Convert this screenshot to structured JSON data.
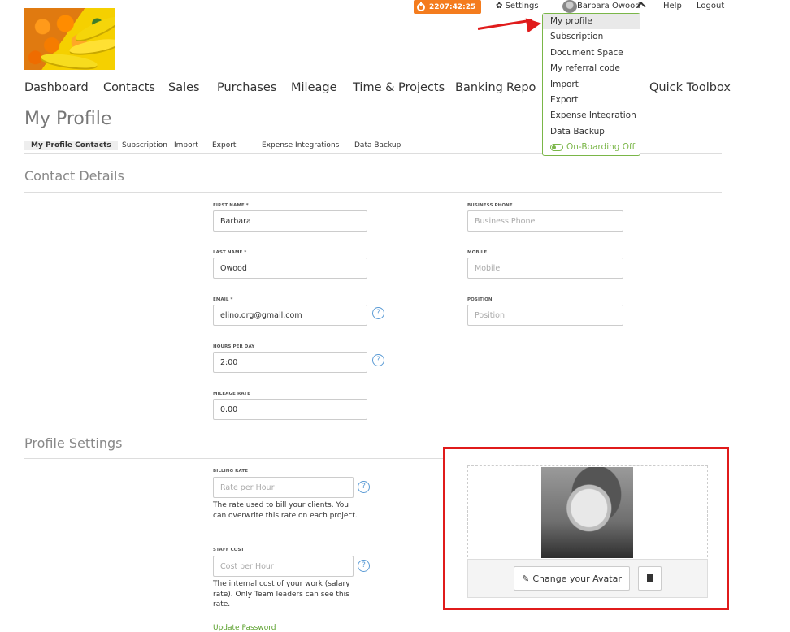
{
  "topbar": {
    "timer": "2207:42:25",
    "settings": "Settings",
    "user_name": "Barbara Owood",
    "help": "Help",
    "logout": "Logout"
  },
  "user_menu": {
    "items": [
      "My profile",
      "Subscription",
      "Document Space",
      "My referral code",
      "Import",
      "Export",
      "Expense Integration",
      "Data Backup"
    ],
    "onboarding": "On-Boarding Off"
  },
  "nav": {
    "items": [
      "Dashboard",
      "Contacts",
      "Sales",
      "Purchases",
      "Mileage",
      "Time & Projects",
      "Banking",
      "Repo",
      "Quick Toolbox"
    ]
  },
  "page": {
    "title": "My Profile",
    "subtabs": [
      "My Profile Contacts",
      "Subscription",
      "Import",
      "Export",
      "Expense Integrations",
      "Data Backup"
    ]
  },
  "contact_details": {
    "title": "Contact Details",
    "first_name": {
      "label": "FIRST NAME *",
      "value": "Barbara"
    },
    "last_name": {
      "label": "LAST NAME *",
      "value": "Owood"
    },
    "email": {
      "label": "EMAIL *",
      "value": "elino.org@gmail.com"
    },
    "hours_per_day": {
      "label": "HOURS PER DAY",
      "value": "2:00"
    },
    "mileage_rate": {
      "label": "MILEAGE RATE",
      "value": "0.00"
    },
    "business_phone": {
      "label": "BUSINESS PHONE",
      "placeholder": "Business Phone"
    },
    "mobile": {
      "label": "MOBILE",
      "placeholder": "Mobile"
    },
    "position": {
      "label": "POSITION",
      "placeholder": "Position"
    }
  },
  "profile_settings": {
    "title": "Profile Settings",
    "billing_rate": {
      "label": "BILLING RATE",
      "placeholder": "Rate per Hour",
      "hint": "The rate used to bill your clients. You can overwrite this rate on each project."
    },
    "staff_cost": {
      "label": "STAFF COST",
      "placeholder": "Cost per Hour",
      "hint": "The internal cost of your work (salary rate). Only Team leaders can see this rate."
    },
    "update_password": "Update Password"
  },
  "avatar": {
    "change_label": "Change your Avatar"
  },
  "colors": {
    "accent": "#7ab648",
    "timer": "#f47c1e",
    "highlight": "#e01b1b"
  },
  "icons": [
    "power-icon",
    "gear-icon",
    "chevron-up-icon",
    "help-icon",
    "pencil-icon",
    "trash-icon",
    "toggle-icon"
  ]
}
